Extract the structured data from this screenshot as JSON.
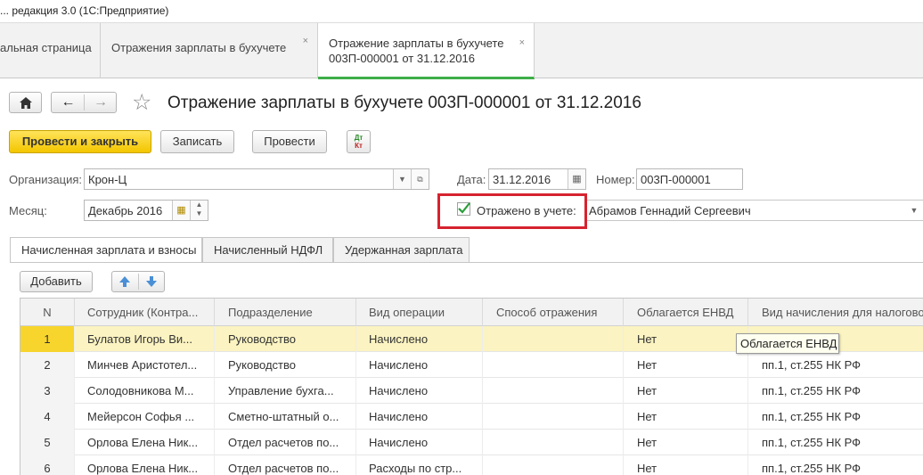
{
  "window": {
    "title": "... редакция 3.0  (1С:Предприятие)"
  },
  "tabs": [
    {
      "label": "альная страница"
    },
    {
      "label": "Отражения зарплаты в бухучете",
      "close": "×"
    },
    {
      "label": "Отражение зарплаты в бухучете",
      "sublabel": "003П-000001 от 31.12.2016",
      "close": "×"
    }
  ],
  "nav": {
    "home_icon": "⌂",
    "back_icon": "←",
    "forward_icon": "→",
    "star_icon": "☆"
  },
  "doc": {
    "title": "Отражение зарплаты в бухучете 003П-000001 от 31.12.2016"
  },
  "toolbar": {
    "post_close": "Провести и закрыть",
    "save": "Записать",
    "post": "Провести",
    "dtkt_top": "Дт",
    "dtkt_bottom": "Кт"
  },
  "form": {
    "org_label": "Организация:",
    "org_value": "Крон-Ц",
    "date_label": "Дата:",
    "date_value": "31.12.2016",
    "number_label": "Номер:",
    "number_value": "003П-000001",
    "month_label": "Месяц:",
    "month_value": "Декабрь 2016",
    "reflected_label": "Отражено в учете:",
    "reflected_checked": true,
    "responsible_value": "Абрамов Геннадий Сергеевич"
  },
  "inner_tabs": [
    {
      "label": "Начисленная зарплата и взносы"
    },
    {
      "label": "Начисленный НДФЛ"
    },
    {
      "label": "Удержанная зарплата"
    }
  ],
  "table_toolbar": {
    "add": "Добавить",
    "up_icon": "up-arrow",
    "down_icon": "down-arrow"
  },
  "table": {
    "columns": [
      "N",
      "Сотрудник (Контра...",
      "Подразделение",
      "Вид операции",
      "Способ отражения",
      "Облагается ЕНВД",
      "Вид начисления для налогово"
    ],
    "rows": [
      {
        "n": "1",
        "employee": "Булатов Игорь Ви...",
        "dept": "Руководство",
        "op": "Начислено",
        "method": "",
        "envd": "Нет",
        "kind": "...К РФ"
      },
      {
        "n": "2",
        "employee": "Минчев Аристотел...",
        "dept": "Руководство",
        "op": "Начислено",
        "method": "",
        "envd": "Нет",
        "kind": "пп.1, ст.255 НК РФ"
      },
      {
        "n": "3",
        "employee": "Солодовникова М...",
        "dept": "Управление бухга...",
        "op": "Начислено",
        "method": "",
        "envd": "Нет",
        "kind": "пп.1, ст.255 НК РФ"
      },
      {
        "n": "4",
        "employee": "Мейерсон Софья ...",
        "dept": "Сметно-штатный о...",
        "op": "Начислено",
        "method": "",
        "envd": "Нет",
        "kind": "пп.1, ст.255 НК РФ"
      },
      {
        "n": "5",
        "employee": "Орлова Елена Ник...",
        "dept": "Отдел расчетов по...",
        "op": "Начислено",
        "method": "",
        "envd": "Нет",
        "kind": "пп.1, ст.255 НК РФ"
      },
      {
        "n": "6",
        "employee": "Орлова Елена Ник...",
        "dept": "Отдел расчетов по...",
        "op": "Расходы по стр...",
        "method": "",
        "envd": "Нет",
        "kind": "пп.1, ст.255 НК РФ"
      }
    ],
    "tooltip": "Облагается ЕНВД"
  },
  "colors": {
    "accent_green": "#3fae49",
    "primary_yellow": "#f3c600",
    "highlight_red": "#d6232f",
    "selected_row": "#fbf3c1"
  }
}
